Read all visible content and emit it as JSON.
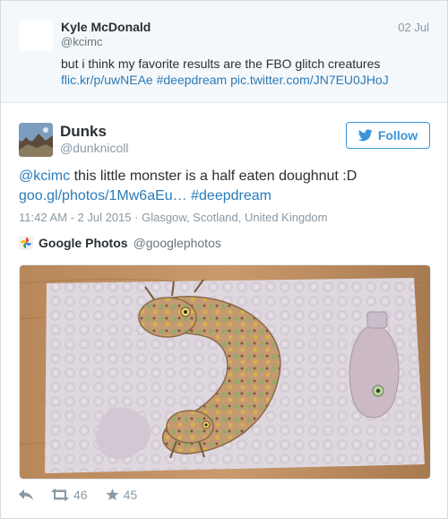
{
  "parent_tweet": {
    "name": "Kyle McDonald",
    "handle": "@kcimc",
    "date": "02 Jul",
    "text": "but i think my favorite results are the FBO glitch creatures",
    "link_flickr": "flic.kr/p/uwNEAe",
    "link_hashtag": "#deepdream",
    "link_pic": "pic.twitter.com/JN7EU0JHoJ"
  },
  "tweet": {
    "name": "Dunks",
    "handle": "@dunknicoll",
    "follow_label": "Follow",
    "mention": "@kcimc",
    "text": " this little monster is a half eaten doughnut :D",
    "link_url": "goo.gl/photos/1Mw6aEu…",
    "link_hashtag": "#deepdream",
    "time": "11:42 AM - 2 Jul 2015",
    "location": "Glasgow, Scotland, United Kingdom"
  },
  "card": {
    "source_name": "Google Photos",
    "source_handle": "@googlephotos"
  },
  "actions": {
    "retweets": "46",
    "likes": "45"
  },
  "colors": {
    "link": "#2b7bb9",
    "follow": "#3b94d9",
    "muted": "#8899a6"
  },
  "icons": {
    "follow": "bird-icon",
    "reply": "reply-icon",
    "retweet": "retweet-icon",
    "like": "star-icon",
    "source": "google-photos-icon"
  }
}
